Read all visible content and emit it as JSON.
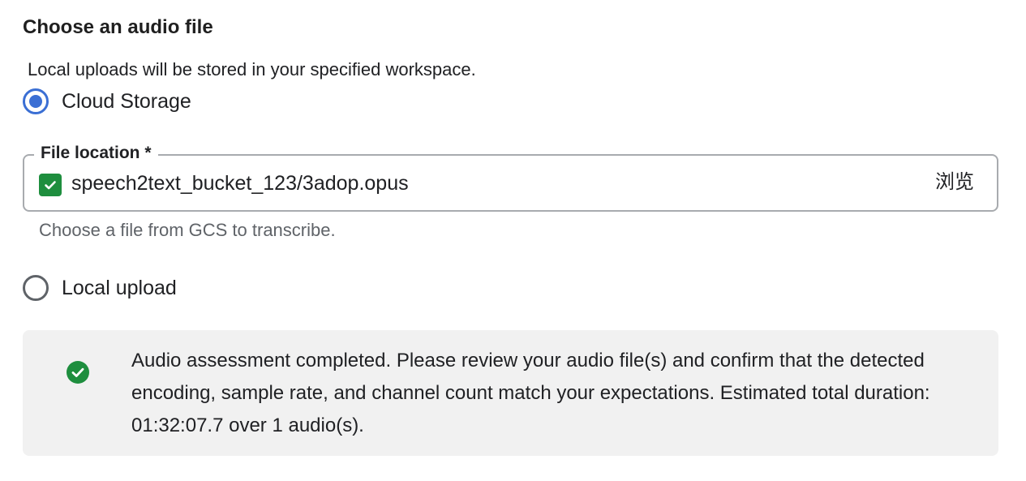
{
  "section": {
    "title": "Choose an audio file",
    "description": "Local uploads will be stored in your specified workspace."
  },
  "options": {
    "cloud_storage": {
      "label": "Cloud Storage",
      "selected": true
    },
    "local_upload": {
      "label": "Local upload",
      "selected": false
    }
  },
  "file_location": {
    "label": "File location *",
    "value": "speech2text_bucket_123/3adop.opus",
    "browse_label": "浏览",
    "hint": "Choose a file from GCS to transcribe."
  },
  "alert": {
    "icon": "check-circle-icon",
    "message": "Audio assessment completed. Please review your audio file(s) and confirm that the detected encoding, sample rate, and channel count match your expectations. Estimated total duration: 01:32:07.7 over 1 audio(s)."
  },
  "colors": {
    "accent": "#3b6fd4",
    "success": "#1e8e3e",
    "alert_background": "#f1f1f1"
  }
}
